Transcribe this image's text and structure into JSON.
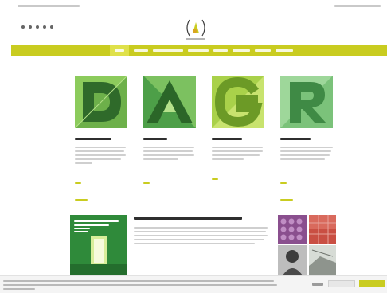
{
  "colors": {
    "accent": "#c9cc20",
    "text_dark": "#2f2f2f",
    "text_muted": "#cfcfcf",
    "page_bg": "#ffffff"
  },
  "header": {
    "social_icons": [
      "facebook-icon",
      "twitter-icon",
      "instagram-icon",
      "youtube-icon",
      "vimeo-icon"
    ],
    "logo": "school-logo"
  },
  "cards": [
    {
      "letter": "D"
    },
    {
      "letter": "A"
    },
    {
      "letter": "G"
    },
    {
      "letter": "R"
    }
  ]
}
